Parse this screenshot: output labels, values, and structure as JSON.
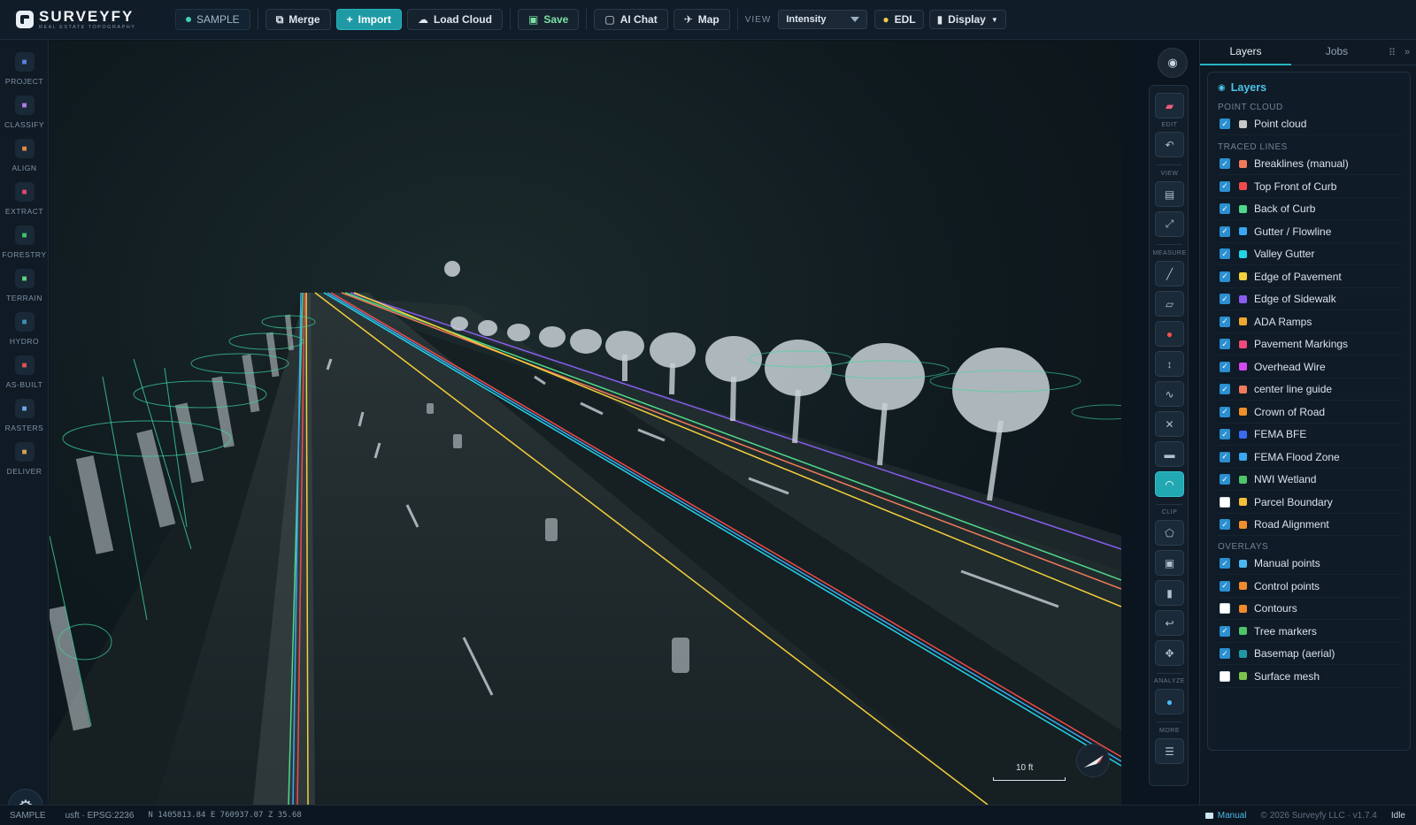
{
  "app": {
    "name": "SURVEYFY",
    "tagline": "REAL ESTATE TOPOGRAPHY"
  },
  "toolbar": {
    "project_chip": "SAMPLE",
    "merge": "Merge",
    "import": "Import",
    "load_cloud": "Load Cloud",
    "save": "Save",
    "ai_chat": "AI Chat",
    "map": "Map",
    "view_label": "VIEW",
    "view_value": "Intensity",
    "edl": "EDL",
    "display": "Display"
  },
  "leftrail": {
    "items": [
      {
        "label": "PROJECT",
        "icon": "square-icon",
        "color": "#5b7fe0"
      },
      {
        "label": "CLASSIFY",
        "icon": "diamond-icon",
        "color": "#b07ae8"
      },
      {
        "label": "ALIGN",
        "icon": "target-icon",
        "color": "#e08a3c"
      },
      {
        "label": "EXTRACT",
        "icon": "pen-icon",
        "color": "#e0467a"
      },
      {
        "label": "FORESTRY",
        "icon": "tree-icon",
        "color": "#3fc46a"
      },
      {
        "label": "TERRAIN",
        "icon": "mountain-icon",
        "color": "#5fd47a"
      },
      {
        "label": "HYDRO",
        "icon": "wave-icon",
        "color": "#3a8fb0"
      },
      {
        "label": "AS-BUILT",
        "icon": "triangle-icon",
        "color": "#e05050"
      },
      {
        "label": "RASTERS",
        "icon": "grid-icon",
        "color": "#6aa8e8"
      },
      {
        "label": "DELIVER",
        "icon": "box-icon",
        "color": "#d4a24a"
      }
    ]
  },
  "viewport": {
    "scale_label": "10 ft"
  },
  "tools": {
    "sections": {
      "edit": "EDIT",
      "view": "VIEW",
      "measure": "MEASURE",
      "clip": "CLIP",
      "analyze": "ANALYZE",
      "more": "MORE"
    }
  },
  "panel": {
    "tabs": [
      "Layers",
      "Jobs"
    ],
    "title": "Layers",
    "groups": {
      "point_cloud": "POINT CLOUD",
      "traced_lines": "TRACED LINES",
      "overlays": "OVERLAYS"
    },
    "point_cloud": [
      {
        "label": "Point cloud",
        "checked": true,
        "color": "#c9c9c9"
      }
    ],
    "traced_lines": [
      {
        "label": "Breaklines (manual)",
        "checked": true,
        "color": "#f07a5a"
      },
      {
        "label": "Top Front of Curb",
        "checked": true,
        "color": "#f04a4a"
      },
      {
        "label": "Back of Curb",
        "checked": true,
        "color": "#4fd88a"
      },
      {
        "label": "Gutter / Flowline",
        "checked": true,
        "color": "#3aa8f0"
      },
      {
        "label": "Valley Gutter",
        "checked": true,
        "color": "#22d3e8"
      },
      {
        "label": "Edge of Pavement",
        "checked": true,
        "color": "#f4d03a"
      },
      {
        "label": "Edge of Sidewalk",
        "checked": true,
        "color": "#8a5cf0"
      },
      {
        "label": "ADA Ramps",
        "checked": true,
        "color": "#f0a830"
      },
      {
        "label": "Pavement Markings",
        "checked": true,
        "color": "#f04a7a"
      },
      {
        "label": "Overhead Wire",
        "checked": true,
        "color": "#d34af0"
      },
      {
        "label": "center line guide",
        "checked": true,
        "color": "#f07a5a"
      },
      {
        "label": "Crown of Road",
        "checked": true,
        "color": "#f0902a"
      },
      {
        "label": "FEMA BFE",
        "checked": true,
        "color": "#3a6af0"
      },
      {
        "label": "FEMA Flood Zone",
        "checked": true,
        "color": "#3aa8f0"
      },
      {
        "label": "NWI Wetland",
        "checked": true,
        "color": "#4fc46a"
      },
      {
        "label": "Parcel Boundary",
        "checked": false,
        "color": "#f4c03a"
      },
      {
        "label": "Road Alignment",
        "checked": true,
        "color": "#f0902a"
      }
    ],
    "overlays": [
      {
        "label": "Manual points",
        "checked": true,
        "color": "#4ab8f0"
      },
      {
        "label": "Control points",
        "checked": true,
        "color": "#f08a2a"
      },
      {
        "label": "Contours",
        "checked": false,
        "color": "#f08a2a"
      },
      {
        "label": "Tree markers",
        "checked": true,
        "color": "#4fc46a"
      },
      {
        "label": "Basemap (aerial)",
        "checked": true,
        "color": "#1f9aa5"
      },
      {
        "label": "Surface mesh",
        "checked": false,
        "color": "#7ac44a"
      }
    ]
  },
  "status": {
    "project": "SAMPLE",
    "units": "usft · EPSG:2236",
    "coords": "N 1405813.84 E 760937.07 Z 35.68",
    "mode": "Manual",
    "copyright": "© 2026 Surveyfy LLC · v1.7.4",
    "state": "Idle"
  }
}
